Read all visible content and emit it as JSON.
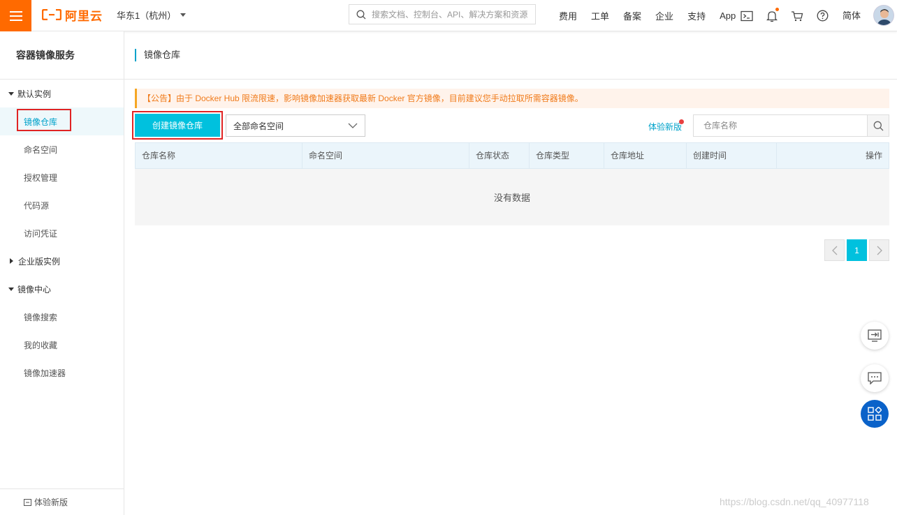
{
  "topbar": {
    "brand": "阿里云",
    "region": "华东1（杭州）",
    "search_placeholder": "搜索文档、控制台、API、解决方案和资源",
    "links": [
      "费用",
      "工单",
      "备案",
      "企业",
      "支持",
      "App"
    ],
    "language": "简体"
  },
  "sidebar": {
    "title": "容器镜像服务",
    "groups": [
      {
        "label": "默认实例",
        "expanded": true,
        "items": [
          "镜像仓库",
          "命名空间",
          "授权管理",
          "代码源",
          "访问凭证"
        ]
      },
      {
        "label": "企业版实例",
        "expanded": false,
        "items": []
      },
      {
        "label": "镜像中心",
        "expanded": true,
        "items": [
          "镜像搜索",
          "我的收藏",
          "镜像加速器"
        ]
      }
    ],
    "active_item": "镜像仓库",
    "bottom_label": "体验新版"
  },
  "main": {
    "title": "镜像仓库",
    "notice": "【公告】由于 Docker Hub 限流限速，影响镜像加速器获取最新 Docker 官方镜像，目前建议您手动拉取所需容器镜像。",
    "create_button": "创建镜像仓库",
    "namespace_select": "全部命名空间",
    "try_new": "体验新版",
    "search_placeholder": "仓库名称",
    "columns": [
      "仓库名称",
      "命名空间",
      "仓库状态",
      "仓库类型",
      "仓库地址",
      "创建时间",
      "操作"
    ],
    "empty_text": "没有数据",
    "current_page": "1"
  },
  "watermark": "https://blog.csdn.net/qq_40977118",
  "colors": {
    "brand": "#ff6a00",
    "primary": "#00c1de",
    "link": "#00a2ca",
    "highlight": "#e02424",
    "notice_text": "#f07b1b"
  }
}
